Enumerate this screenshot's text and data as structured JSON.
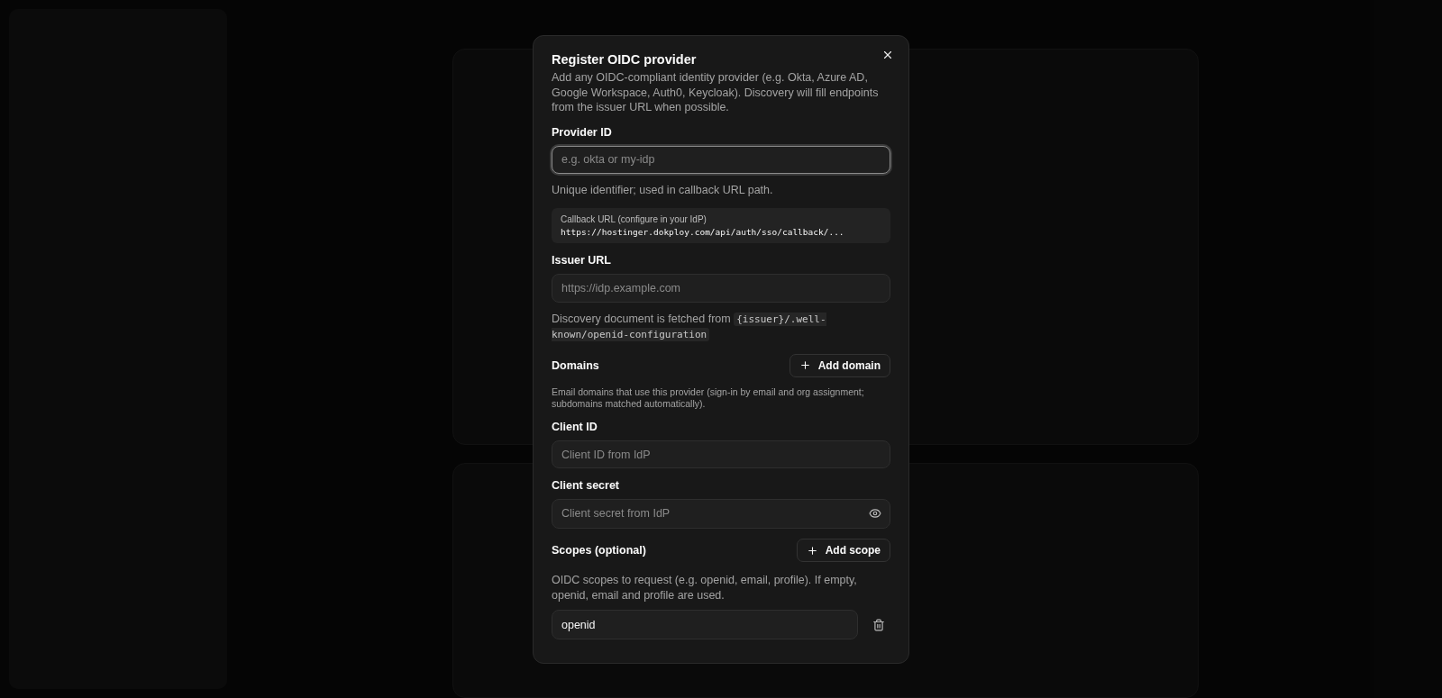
{
  "dialog": {
    "title": "Register OIDC provider",
    "description": "Add any OIDC-compliant identity provider (e.g. Okta, Azure AD, Google Workspace, Auth0, Keycloak). Discovery will fill endpoints from the issuer URL when possible.",
    "provider_id": {
      "label": "Provider ID",
      "placeholder": "e.g. okta or my-idp",
      "hint": "Unique identifier; used in callback URL path.",
      "focused": true
    },
    "callback": {
      "label": "Callback URL (configure in your IdP)",
      "url": "https://hostinger.dokploy.com/api/auth/sso/callback/..."
    },
    "issuer_url": {
      "label": "Issuer URL",
      "placeholder": "https://idp.example.com",
      "hint": "Discovery document is fetched from",
      "hint_code": "{issuer}/.well-known/openid-configuration"
    },
    "domains": {
      "label": "Domains",
      "button": "Add domain",
      "hint": "Email domains that use this provider (sign-in by email and org assignment; subdomains matched automatically)."
    },
    "client_id": {
      "label": "Client ID",
      "placeholder": "Client ID from IdP"
    },
    "client_secret": {
      "label": "Client secret",
      "placeholder": "Client secret from IdP"
    },
    "scopes": {
      "label": "Scopes (optional)",
      "button": "Add scope",
      "hint": "OIDC scopes to request (e.g. openid, email, profile). If empty, openid, email and profile are used.",
      "items": [
        {
          "value": "openid"
        }
      ]
    }
  }
}
